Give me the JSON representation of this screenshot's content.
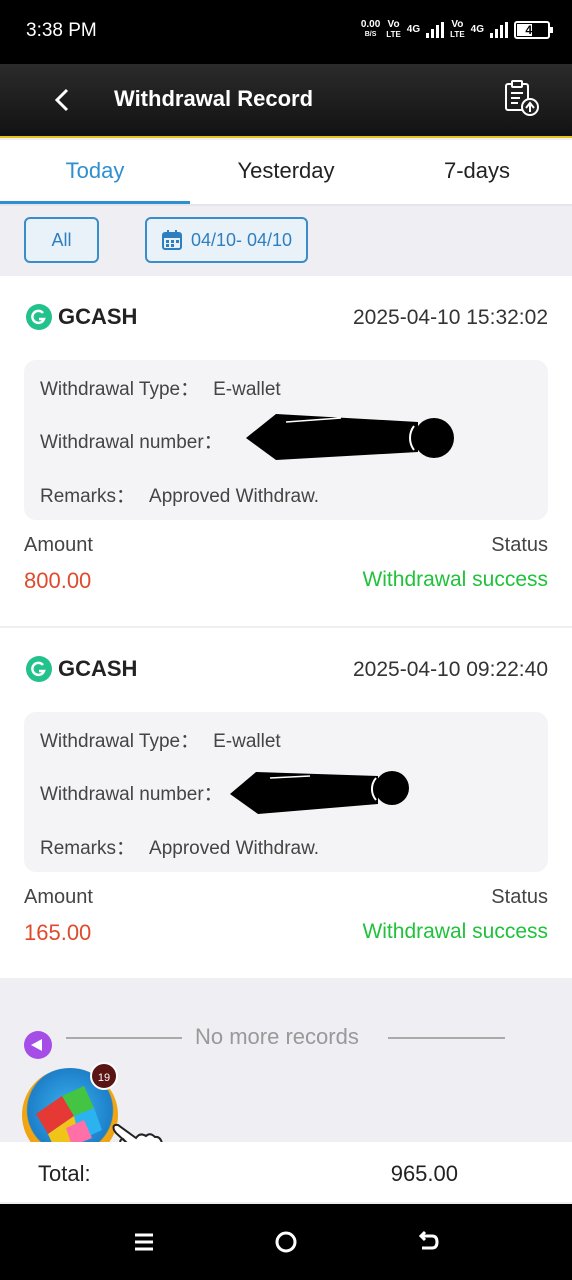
{
  "status_bar": {
    "time": "3:38 PM",
    "net_speed_value": "0.00",
    "net_speed_unit": "B/S",
    "sim1_top": "Vo",
    "sim1_bottom": "LTE",
    "sim1_gen": "4G",
    "sim2_top": "Vo",
    "sim2_bottom": "LTE",
    "sim2_gen": "4G",
    "battery": "48"
  },
  "header": {
    "title": "Withdrawal Record",
    "back_icon": "chevron-left-icon",
    "action_icon": "clipboard-upload-icon"
  },
  "tabs": [
    {
      "label": "Today",
      "active": true
    },
    {
      "label": "Yesterday",
      "active": false
    },
    {
      "label": "7-days",
      "active": false
    }
  ],
  "filters": {
    "all_label": "All",
    "date_range": "04/10- 04/10",
    "calendar_icon": "calendar-icon"
  },
  "records": [
    {
      "brand": "GCASH",
      "datetime": "2025-04-10 15:32:02",
      "type_label": "Withdrawal Type：",
      "type_value": "E-wallet",
      "number_label": "Withdrawal number：",
      "remarks_label": "Remarks：",
      "remarks_value": "Approved Withdraw.",
      "amount_label": "Amount",
      "amount": "800.00",
      "status_label": "Status",
      "status": "Withdrawal success"
    },
    {
      "brand": "GCASH",
      "datetime": "2025-04-10 09:22:40",
      "type_label": "Withdrawal Type：",
      "type_value": "E-wallet",
      "number_label": "Withdrawal number：",
      "remarks_label": "Remarks：",
      "remarks_value": "Approved Withdraw.",
      "amount_label": "Amount",
      "amount": "165.00",
      "status_label": "Status",
      "status": "Withdrawal success"
    }
  ],
  "footer_text": "No more records",
  "floating": {
    "badge_count": "19"
  },
  "total": {
    "label": "Total:",
    "value": "965.00"
  },
  "colors": {
    "accent": "#2f8fd0",
    "amount": "#e04a2c",
    "success": "#1fc23a",
    "header_border": "#e6c21a"
  }
}
